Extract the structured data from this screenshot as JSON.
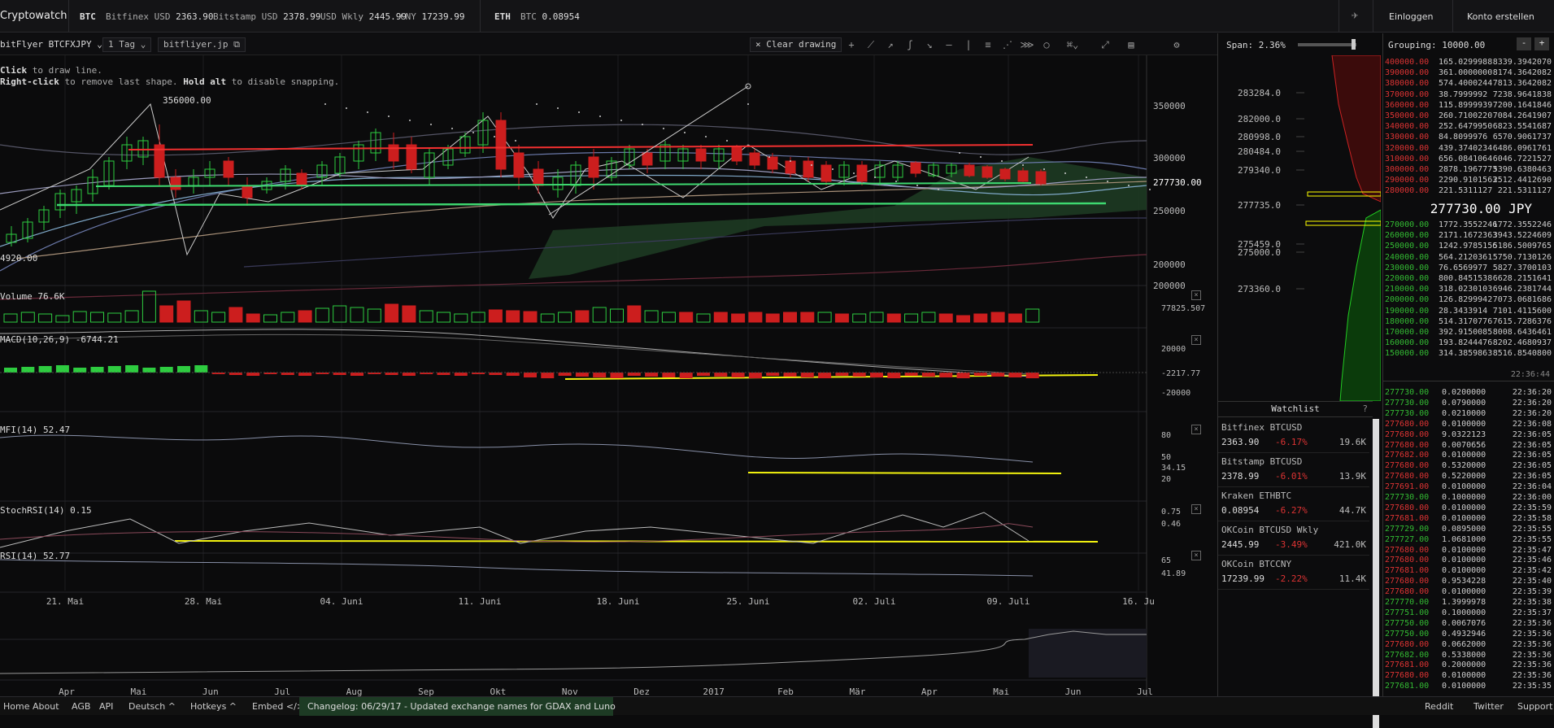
{
  "topbar": {
    "brand": "Cryptowatch",
    "btc_label": "BTC",
    "btc_tickers": [
      {
        "name": "Bitfinex USD",
        "value": "2363.90"
      },
      {
        "name": "Bitstamp USD",
        "value": "2378.99"
      },
      {
        "name": "USD Wkly",
        "value": "2445.99"
      },
      {
        "name": "CNY",
        "value": "17239.99"
      }
    ],
    "eth_label": "ETH",
    "eth_tickers": [
      {
        "name": "BTC",
        "value": "0.08954"
      }
    ],
    "login": "Einloggen",
    "register": "Konto erstellen"
  },
  "chartbar": {
    "market": "bitFlyer BTCFXJPY",
    "interval": "1 Tag",
    "link": "bitfliyer.jp",
    "clear": "Clear drawing"
  },
  "hint": {
    "line1_a": "Click",
    "line1_b": " to draw line.",
    "line2_a": "Right-click",
    "line2_b": " to remove last shape. ",
    "line2_c": "Hold alt",
    "line2_d": " to disable snapping."
  },
  "panels": {
    "volume": {
      "label": "Volume",
      "value": "76.6K",
      "axis": [
        "77825.507"
      ]
    },
    "macd": {
      "label": "MACD(10,26,9)",
      "value": "-6744.21",
      "axis": [
        "20000",
        "-2217.77",
        "-20000"
      ]
    },
    "mfi": {
      "label": "MFI(14)",
      "value": "52.47",
      "axis": [
        "80",
        "50",
        "34.15",
        "20"
      ]
    },
    "stochrsi": {
      "label": "StochRSI(14)",
      "value": "0.15",
      "axis": [
        "0.75",
        "0.46"
      ]
    },
    "rsi": {
      "label": "RSI(14)",
      "value": "52.77",
      "axis": [
        "65",
        "41.89"
      ]
    }
  },
  "price_axis": [
    "350000",
    "300000",
    "277730.00",
    "250000",
    "200000",
    "200000"
  ],
  "annotations": {
    "high": "356000.00",
    "low": "4920.00"
  },
  "date_axis": [
    "21. Mai",
    "28. Mai",
    "04. Juni",
    "11. Juni",
    "18. Juni",
    "25. Juni",
    "02. Juli",
    "09. Juli",
    "16. Ju"
  ],
  "overview_axis": [
    "Apr",
    "Mai",
    "Jun",
    "Jul",
    "Aug",
    "Sep",
    "Okt",
    "Nov",
    "Dez",
    "2017",
    "Feb",
    "Mär",
    "Apr",
    "Mai",
    "Jun",
    "Jul"
  ],
  "depth": {
    "span_label": "Span: 2.36%",
    "levels": [
      "283284.0",
      "282000.0",
      "280998.0",
      "280484.0",
      "279340.0",
      "277735.0",
      "275459.0",
      "275000.0",
      "273360.0"
    ]
  },
  "watchlist": {
    "title": "Watchlist",
    "help": "?",
    "items": [
      {
        "name": "Bitfinex BTCUSD",
        "price": "2363.90",
        "change": "-6.17%",
        "vol": "19.6K"
      },
      {
        "name": "Bitstamp BTCUSD",
        "price": "2378.99",
        "change": "-6.01%",
        "vol": "13.9K"
      },
      {
        "name": "Kraken ETHBTC",
        "price": "0.08954",
        "change": "-6.27%",
        "vol": "44.7K"
      },
      {
        "name": "OKCoin BTCUSD Wkly",
        "price": "2445.99",
        "change": "-3.49%",
        "vol": "421.0K"
      },
      {
        "name": "OKCoin BTCCNY",
        "price": "17239.99",
        "change": "-2.22%",
        "vol": "11.4K"
      }
    ]
  },
  "orderbook": {
    "grouping": "Grouping: 10000.00",
    "minus": "-",
    "plus": "+",
    "mid": "277730.00 JPY",
    "asks": [
      [
        "400000.00",
        "165.0299988",
        "8339.3942070"
      ],
      [
        "390000.00",
        "361.0000000",
        "8174.3642082"
      ],
      [
        "380000.00",
        "574.4000244",
        "7813.3642082"
      ],
      [
        "370000.00",
        "38.7999992",
        "7238.9641838"
      ],
      [
        "360000.00",
        "115.8999939",
        "7200.1641846"
      ],
      [
        "350000.00",
        "260.7100220",
        "7084.2641907"
      ],
      [
        "340000.00",
        "252.6479950",
        "6823.5541687"
      ],
      [
        "330000.00",
        "84.8099976",
        "6570.9061737"
      ],
      [
        "320000.00",
        "439.3740234",
        "6486.0961761"
      ],
      [
        "310000.00",
        "656.0841064",
        "6046.7221527"
      ],
      [
        "300000.00",
        "2878.1967773",
        "5390.6380463"
      ],
      [
        "290000.00",
        "2290.9101563",
        "2512.4412690"
      ],
      [
        "280000.00",
        "221.5311127",
        "221.5311127"
      ]
    ],
    "bids": [
      [
        "270000.00",
        "1772.3552246",
        "1772.3552246"
      ],
      [
        "260000.00",
        "2171.1672363",
        "3943.5224609"
      ],
      [
        "250000.00",
        "1242.9785156",
        "5186.5009765"
      ],
      [
        "240000.00",
        "564.2120361",
        "5750.7130126"
      ],
      [
        "230000.00",
        "76.6569977",
        "5827.3700103"
      ],
      [
        "220000.00",
        "800.8451538",
        "6628.2151641"
      ],
      [
        "210000.00",
        "318.0230103",
        "6946.2381744"
      ],
      [
        "200000.00",
        "126.8299942",
        "7073.0681686"
      ],
      [
        "190000.00",
        "28.3433914",
        "7101.4115600"
      ],
      [
        "180000.00",
        "514.3170776",
        "7615.7286376"
      ],
      [
        "170000.00",
        "392.9150085",
        "8008.6436461"
      ],
      [
        "160000.00",
        "193.8244476",
        "8202.4680937"
      ],
      [
        "150000.00",
        "314.3859863",
        "8516.8540800"
      ]
    ],
    "trades_time_header": "22:36:44",
    "trades": [
      [
        "277730.00",
        "0.0200000",
        "22:36:20",
        "g"
      ],
      [
        "277730.00",
        "0.0790000",
        "22:36:20",
        "g"
      ],
      [
        "277730.00",
        "0.0210000",
        "22:36:20",
        "g"
      ],
      [
        "277680.00",
        "0.0100000",
        "22:36:08",
        "r"
      ],
      [
        "277680.00",
        "9.0322123",
        "22:36:05",
        "r"
      ],
      [
        "277680.00",
        "0.0070656",
        "22:36:05",
        "r"
      ],
      [
        "277682.00",
        "0.0100000",
        "22:36:05",
        "r"
      ],
      [
        "277680.00",
        "0.5320000",
        "22:36:05",
        "r"
      ],
      [
        "277680.00",
        "0.5220000",
        "22:36:05",
        "r"
      ],
      [
        "277691.00",
        "0.0100000",
        "22:36:04",
        "r"
      ],
      [
        "277730.00",
        "0.1000000",
        "22:36:00",
        "g"
      ],
      [
        "277680.00",
        "0.0100000",
        "22:35:59",
        "r"
      ],
      [
        "277681.00",
        "0.0100000",
        "22:35:58",
        "r"
      ],
      [
        "277729.00",
        "0.0895000",
        "22:35:55",
        "g"
      ],
      [
        "277727.00",
        "1.0681000",
        "22:35:55",
        "g"
      ],
      [
        "277680.00",
        "0.0100000",
        "22:35:47",
        "r"
      ],
      [
        "277680.00",
        "0.0100000",
        "22:35:46",
        "r"
      ],
      [
        "277681.00",
        "0.0100000",
        "22:35:42",
        "r"
      ],
      [
        "277680.00",
        "0.9534228",
        "22:35:40",
        "r"
      ],
      [
        "277680.00",
        "0.0100000",
        "22:35:39",
        "r"
      ],
      [
        "277770.00",
        "1.3999978",
        "22:35:38",
        "g"
      ],
      [
        "277751.00",
        "0.1000000",
        "22:35:37",
        "g"
      ],
      [
        "277750.00",
        "0.0067076",
        "22:35:36",
        "g"
      ],
      [
        "277750.00",
        "0.4932946",
        "22:35:36",
        "g"
      ],
      [
        "277680.00",
        "0.0662000",
        "22:35:36",
        "r"
      ],
      [
        "277682.00",
        "0.5338000",
        "22:35:36",
        "g"
      ],
      [
        "277681.00",
        "0.2000000",
        "22:35:36",
        "r"
      ],
      [
        "277680.00",
        "0.0100000",
        "22:35:36",
        "r"
      ],
      [
        "277681.00",
        "0.0100000",
        "22:35:35",
        "g"
      ]
    ]
  },
  "footer": {
    "items": [
      "Home",
      "About",
      "AGB",
      "API",
      "Deutsch ^",
      "Hotkeys ^",
      "Embed </>"
    ],
    "changelog": "Changelog: 06/29/17 - Updated exchange names for GDAX and Luno",
    "right": [
      "Reddit",
      "Twitter",
      "Support"
    ]
  },
  "colors": {
    "up": "#2ecc40",
    "down": "#cc1e1e",
    "drawing_yellow": "#f2f20f",
    "drawing_green": "#3ed870",
    "drawing_red": "#f23030"
  }
}
